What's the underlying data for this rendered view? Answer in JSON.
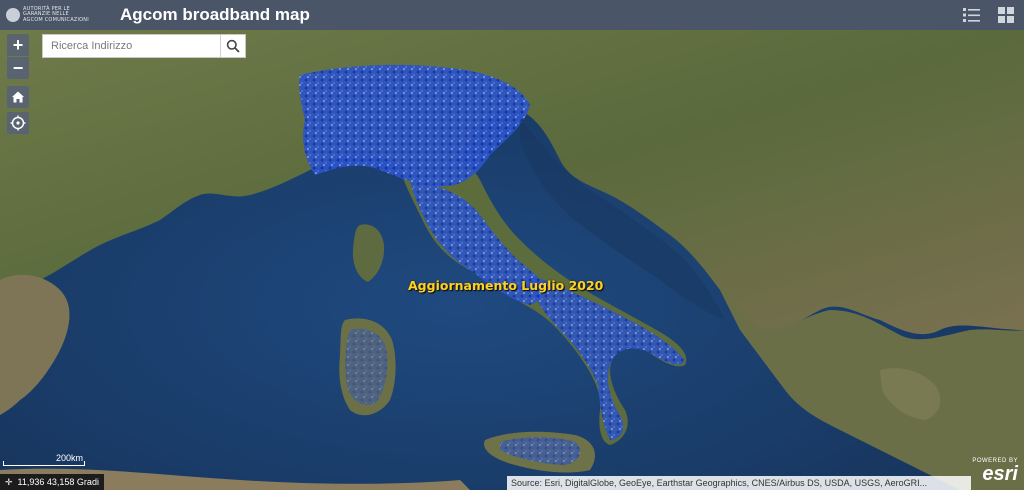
{
  "header": {
    "logo_text_lines": [
      "AUTORITÀ PER LE",
      "GARANZIE NELLE",
      "AGCOM COMUNICAZIONI"
    ],
    "title": "Agcom broadband map",
    "icons": [
      "list-icon",
      "grid-icon"
    ]
  },
  "search": {
    "placeholder": "Ricerca Indirizzo"
  },
  "controls": {
    "zoom_in": "+",
    "zoom_out": "−"
  },
  "map": {
    "overlay_label": "Aggiornamento Luglio 2020",
    "scale_label": "200km",
    "coordinates": "11,936 43,158 Gradi",
    "attribution": "Source: Esri, DigitalGlobe, GeoEye, Earthstar Geographics, CNES/Airbus DS, USDA, USGS, AeroGRI...",
    "powered_by": "POWERED BY",
    "provider": "esri"
  },
  "colors": {
    "header_bg": "#4a5568",
    "sea": "#1e3f6e",
    "land": "#5b6a3e",
    "coverage": "#1e4bd6",
    "label": "#ffd21e"
  }
}
